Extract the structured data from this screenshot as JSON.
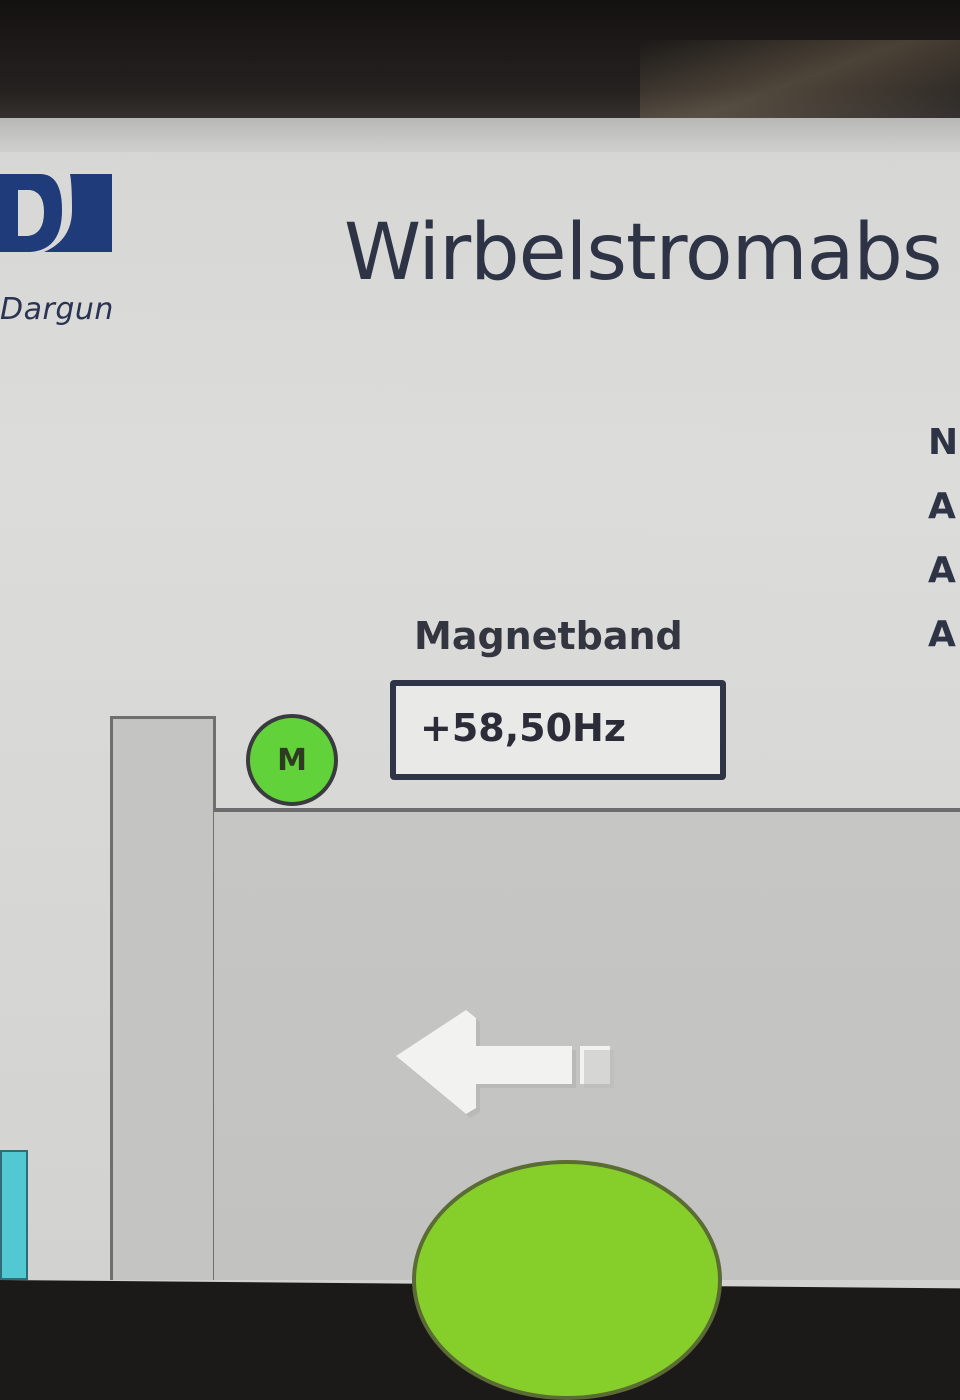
{
  "header": {
    "logo_text": "Dargun",
    "title": "Wirbelstromabs"
  },
  "right_panel": {
    "items": [
      "N",
      "A",
      "A",
      "A"
    ]
  },
  "magnetband": {
    "label": "Magnetband",
    "frequency": "+58,50Hz",
    "motor_indicator": "M",
    "motor_color": "#62d23a",
    "direction": "left"
  },
  "colors": {
    "drum": "#86cf2a",
    "accent_cyan": "#52c9d2",
    "logo_blue": "#1f3b7a"
  }
}
